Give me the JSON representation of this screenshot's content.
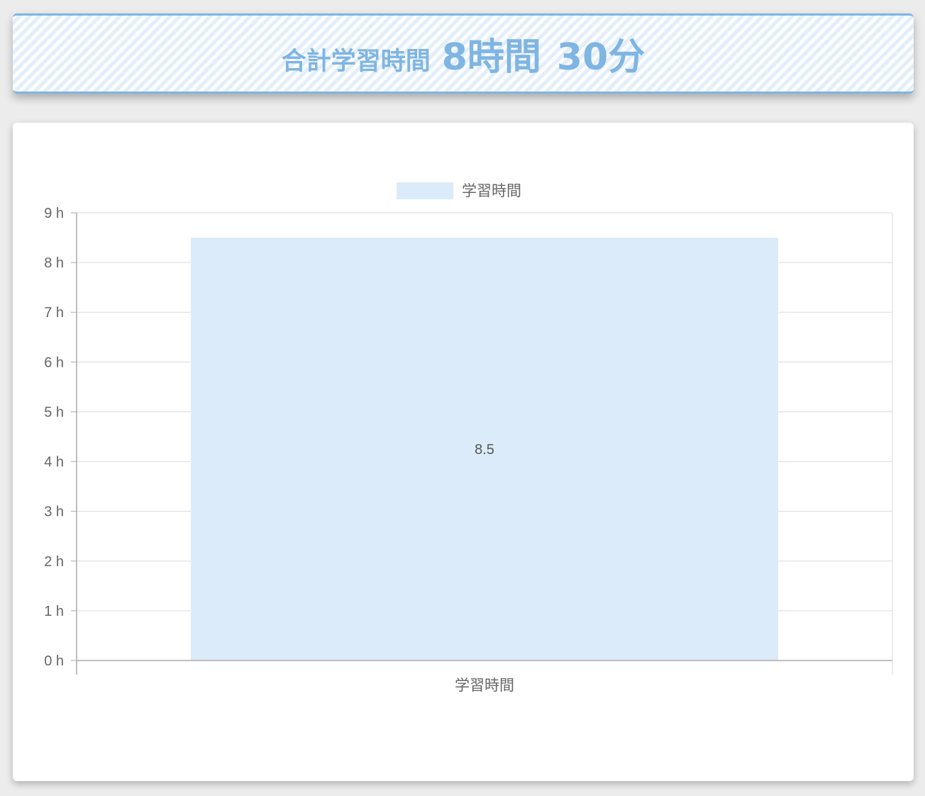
{
  "summary": {
    "label": "合計学習時間",
    "hours": "8",
    "hours_unit": "時間",
    "minutes": "30",
    "minutes_unit": "分",
    "accent_color": "#7fb5e2"
  },
  "chart_data": {
    "type": "bar",
    "categories": [
      "学習時間"
    ],
    "series": [
      {
        "name": "学習時間",
        "values": [
          8.5
        ],
        "color": "#dcebf9"
      }
    ],
    "data_labels": [
      "8.5"
    ],
    "y_tick_labels": [
      "0 h",
      "1 h",
      "2 h",
      "3 h",
      "4 h",
      "5 h",
      "6 h",
      "7 h",
      "8 h",
      "9 h"
    ],
    "ylim": [
      0,
      9
    ],
    "y_step": 1,
    "grid": true,
    "legend_position": "top"
  }
}
